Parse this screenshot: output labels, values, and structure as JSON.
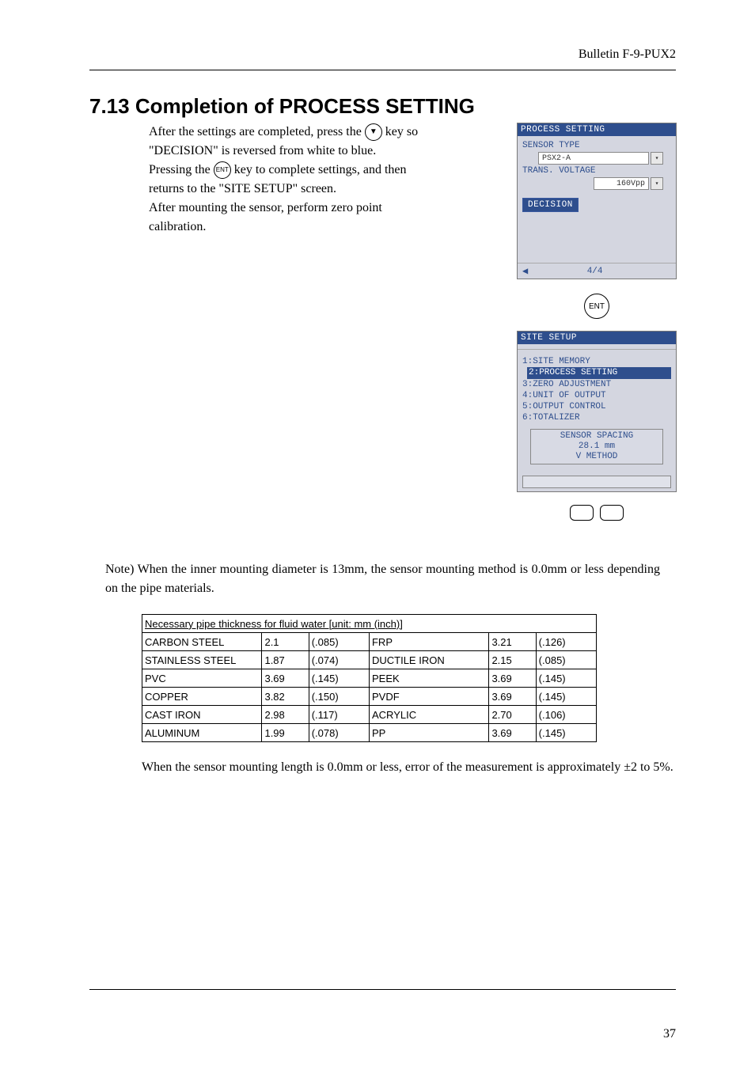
{
  "header": {
    "bulletin": "Bulletin F-9-PUX2"
  },
  "section": {
    "heading": "7.13  Completion of PROCESS SETTING"
  },
  "body": {
    "p1a": "After the settings are completed, press the ",
    "p1b": " key so \"DECISION\" is reversed from white to blue.",
    "p2a": "Pressing the ",
    "p2b": " key to complete settings, and then returns to the \"SITE SETUP\" screen.",
    "p3": "After mounting the sensor, perform zero point calibration."
  },
  "keys": {
    "down": "▼",
    "ent": "ENT",
    "big_ent": "ENT"
  },
  "screen1": {
    "title": "PROCESS SETTING",
    "sensor_type_label": "SENSOR TYPE",
    "sensor_type_value": "PSX2-A",
    "trans_voltage_label": "TRANS. VOLTAGE",
    "trans_voltage_value": "160Vpp",
    "decision": "DECISION",
    "page": "4/4"
  },
  "screen2": {
    "title": "SITE SETUP",
    "menu": [
      "1:SITE MEMORY",
      "2:PROCESS SETTING",
      "3:ZERO ADJUSTMENT",
      "4:UNIT OF OUTPUT",
      "5:OUTPUT CONTROL",
      "6:TOTALIZER"
    ],
    "selected_index": 1,
    "spacing_title": "SENSOR SPACING",
    "spacing_value": "28.1 mm",
    "spacing_method": "V METHOD"
  },
  "note": {
    "prefix": "Note)",
    "text": "When the inner mounting diameter is 13mm, the sensor mounting method is 0.0mm or less depending on the pipe materials."
  },
  "table": {
    "caption": "Necessary pipe thickness for fluid water [unit: mm (inch)]",
    "rows": [
      {
        "m1": "CARBON STEEL",
        "v1": "2.1",
        "i1": "(.085)",
        "m2": "FRP",
        "v2": "3.21",
        "i2": "(.126)"
      },
      {
        "m1": "STAINLESS STEEL",
        "v1": "1.87",
        "i1": "(.074)",
        "m2": "DUCTILE IRON",
        "v2": "2.15",
        "i2": "(.085)"
      },
      {
        "m1": "PVC",
        "v1": "3.69",
        "i1": "(.145)",
        "m2": "PEEK",
        "v2": "3.69",
        "i2": "(.145)"
      },
      {
        "m1": "COPPER",
        "v1": "3.82",
        "i1": "(.150)",
        "m2": "PVDF",
        "v2": "3.69",
        "i2": "(.145)"
      },
      {
        "m1": "CAST IRON",
        "v1": "2.98",
        "i1": "(.117)",
        "m2": "ACRYLIC",
        "v2": "2.70",
        "i2": "(.106)"
      },
      {
        "m1": "ALUMINUM",
        "v1": "1.99",
        "i1": "(.078)",
        "m2": "PP",
        "v2": "3.69",
        "i2": "(.145)"
      }
    ]
  },
  "post_table": "When the sensor mounting length is 0.0mm or less, error of the measurement is approximately ±2 to 5%.",
  "page_number": "37"
}
